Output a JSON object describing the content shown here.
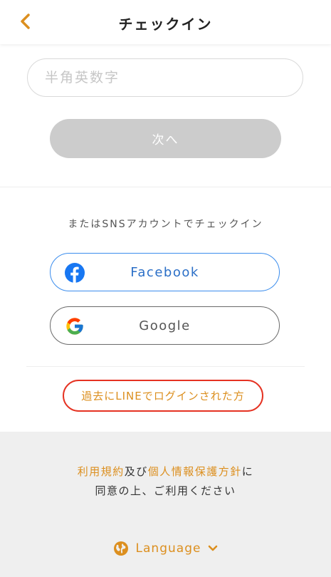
{
  "header": {
    "title": "チェックイン"
  },
  "form": {
    "input_placeholder": "半角英数字",
    "input_value": "",
    "next_label": "次へ"
  },
  "sns": {
    "heading": "またはSNSアカウントでチェックイン",
    "facebook_label": "Facebook",
    "google_label": "Google"
  },
  "line_link": "過去にLINEでログインされた方",
  "footer": {
    "terms_link": "利用規約",
    "and_text": "及び",
    "privacy_link": "個人情報保護方針",
    "ni_text": "に",
    "agree_text": "同意の上、ご利用ください",
    "language_label": "Language"
  },
  "colors": {
    "accent": "#dc8f1f",
    "facebook": "#1877f2",
    "highlight": "#e53222"
  }
}
